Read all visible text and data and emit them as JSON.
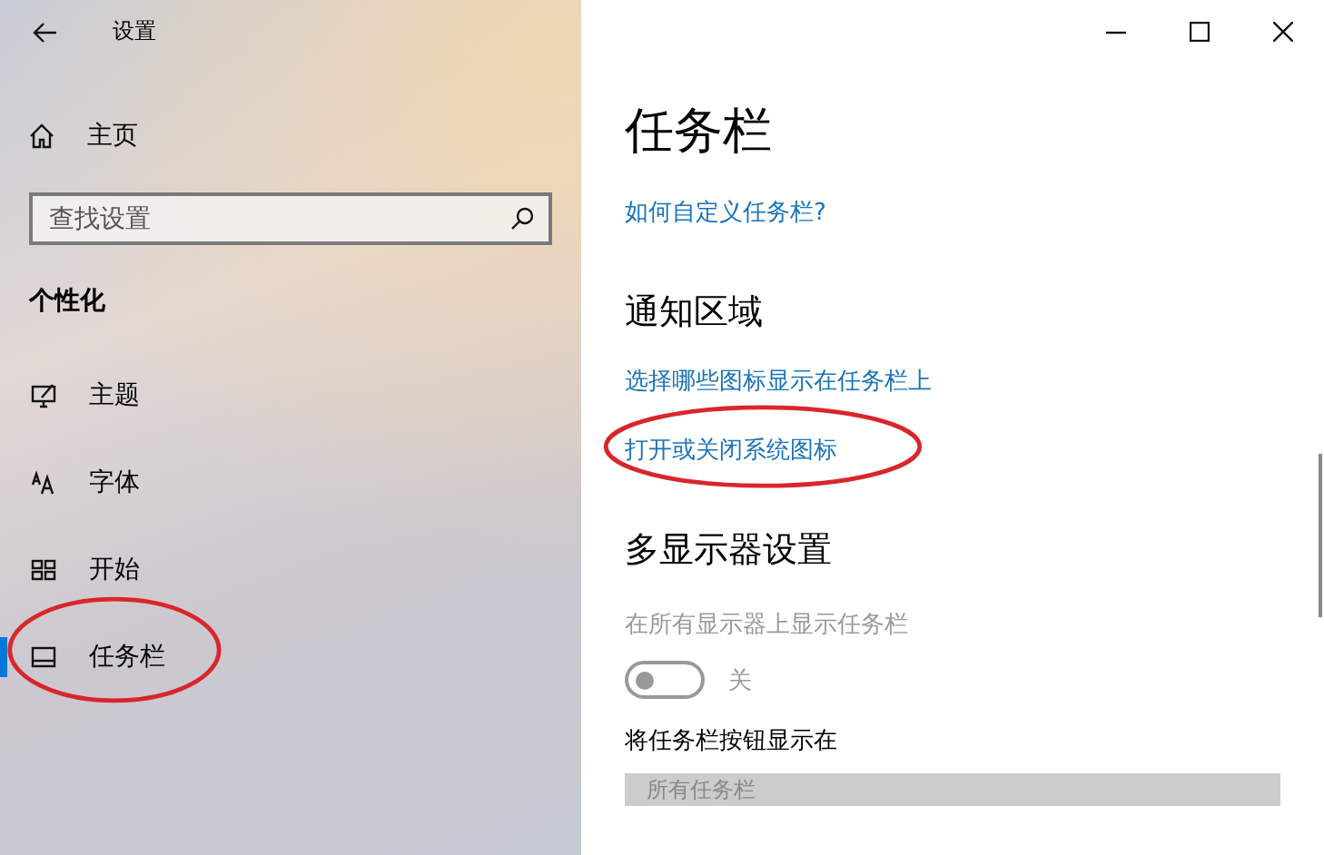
{
  "window": {
    "title": "设置"
  },
  "sidebar": {
    "home": "主页",
    "search": {
      "placeholder": "查找设置"
    },
    "section": "个性化",
    "items": [
      {
        "label": "主题",
        "selected": false,
        "circled": false
      },
      {
        "label": "字体",
        "selected": false,
        "circled": false
      },
      {
        "label": "开始",
        "selected": false,
        "circled": false
      },
      {
        "label": "任务栏",
        "selected": true,
        "circled": true
      }
    ]
  },
  "content": {
    "title": "任务栏",
    "blocks": [
      {
        "kind": "link",
        "text": "如何自定义任务栏?",
        "circled": false
      },
      {
        "kind": "heading",
        "text": "通知区域"
      },
      {
        "kind": "link",
        "text": "选择哪些图标显示在任务栏上",
        "circled": false
      },
      {
        "kind": "link",
        "text": "打开或关闭系统图标",
        "circled": true
      },
      {
        "kind": "heading",
        "text": "多显示器设置"
      },
      {
        "kind": "toggle",
        "label": "在所有显示器上显示任务栏",
        "state": "关",
        "on": false,
        "disabled": true
      },
      {
        "kind": "dropdown",
        "label": "将任务栏按钮显示在",
        "value": "所有任务栏",
        "disabled": true
      }
    ]
  }
}
